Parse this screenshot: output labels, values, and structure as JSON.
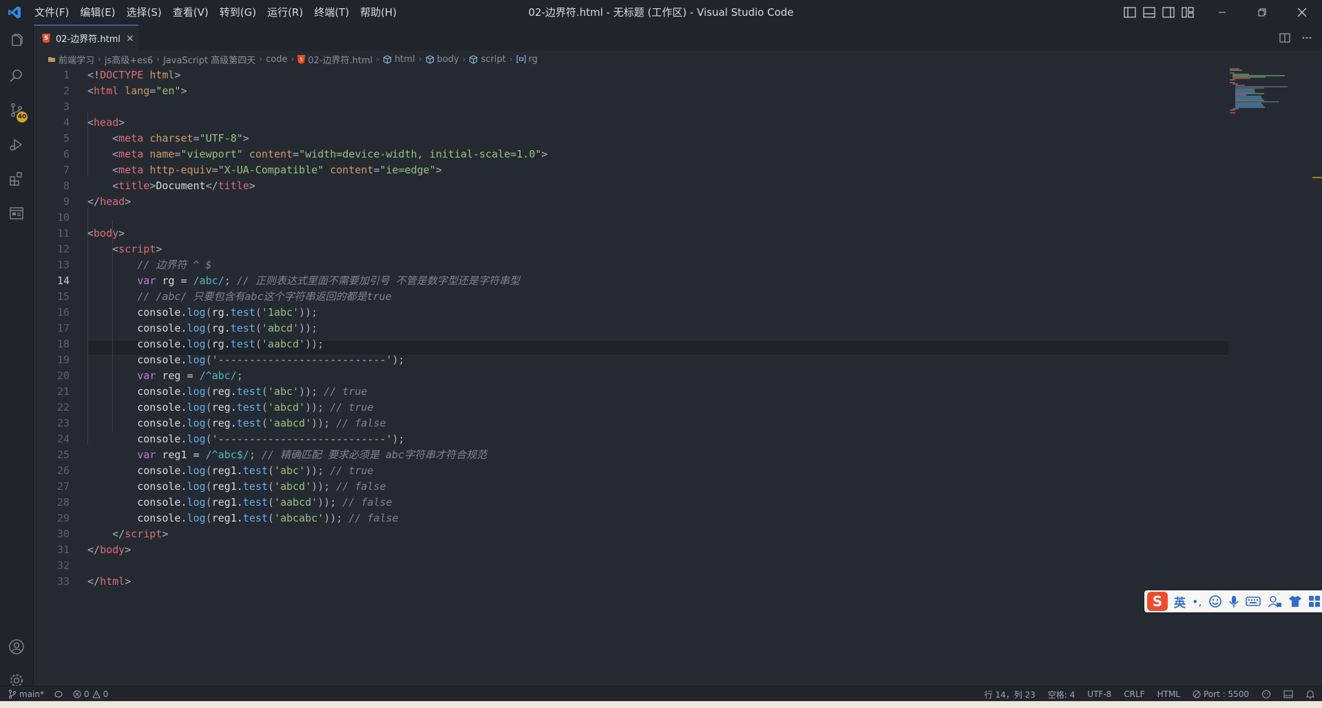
{
  "window": {
    "title": "02-边界符.html - 无标题 (工作区) - Visual Studio Code"
  },
  "menu": [
    "文件(F)",
    "编辑(E)",
    "选择(S)",
    "查看(V)",
    "转到(G)",
    "运行(R)",
    "终端(T)",
    "帮助(H)"
  ],
  "activity": {
    "scm_badge": "40"
  },
  "tab": {
    "label": "02-边界符.html",
    "close": "×",
    "icon_text": "5"
  },
  "breadcrumb": [
    {
      "label": "前端学习",
      "icon": "folder-icon"
    },
    {
      "label": "js高级+es6",
      "icon": ""
    },
    {
      "label": "JavaScript 高级第四天",
      "icon": ""
    },
    {
      "label": "code",
      "icon": ""
    },
    {
      "label": "02-边界符.html",
      "icon": "html5-icon"
    },
    {
      "label": "html",
      "icon": "cube-icon"
    },
    {
      "label": "body",
      "icon": "cube-icon"
    },
    {
      "label": "script",
      "icon": "cube-icon"
    },
    {
      "label": "rg",
      "icon": "variable-icon"
    }
  ],
  "editor": {
    "active_line": 14,
    "lines": [
      [
        [
          "t-punc",
          "<!"
        ],
        [
          "t-tag",
          "DOCTYPE"
        ],
        [
          "t-plain",
          " "
        ],
        [
          "t-attr",
          "html"
        ],
        [
          "t-punc",
          ">"
        ]
      ],
      [
        [
          "t-punc",
          "<"
        ],
        [
          "t-tag",
          "html"
        ],
        [
          "t-plain",
          " "
        ],
        [
          "t-attr",
          "lang"
        ],
        [
          "t-punc",
          "="
        ],
        [
          "t-str",
          "\"en\""
        ],
        [
          "t-punc",
          ">"
        ]
      ],
      [],
      [
        [
          "t-punc",
          "<"
        ],
        [
          "t-tag",
          "head"
        ],
        [
          "t-punc",
          ">"
        ]
      ],
      [
        [
          "t-plain",
          "    "
        ],
        [
          "t-punc",
          "<"
        ],
        [
          "t-tag",
          "meta"
        ],
        [
          "t-plain",
          " "
        ],
        [
          "t-attr",
          "charset"
        ],
        [
          "t-punc",
          "="
        ],
        [
          "t-str",
          "\"UTF-8\""
        ],
        [
          "t-punc",
          ">"
        ]
      ],
      [
        [
          "t-plain",
          "    "
        ],
        [
          "t-punc",
          "<"
        ],
        [
          "t-tag",
          "meta"
        ],
        [
          "t-plain",
          " "
        ],
        [
          "t-attr",
          "name"
        ],
        [
          "t-punc",
          "="
        ],
        [
          "t-str",
          "\"viewport\""
        ],
        [
          "t-plain",
          " "
        ],
        [
          "t-attr",
          "content"
        ],
        [
          "t-punc",
          "="
        ],
        [
          "t-str",
          "\"width=device-width, initial-scale=1.0\""
        ],
        [
          "t-punc",
          ">"
        ]
      ],
      [
        [
          "t-plain",
          "    "
        ],
        [
          "t-punc",
          "<"
        ],
        [
          "t-tag",
          "meta"
        ],
        [
          "t-plain",
          " "
        ],
        [
          "t-attr",
          "http-equiv"
        ],
        [
          "t-punc",
          "="
        ],
        [
          "t-str",
          "\"X-UA-Compatible\""
        ],
        [
          "t-plain",
          " "
        ],
        [
          "t-attr",
          "content"
        ],
        [
          "t-punc",
          "="
        ],
        [
          "t-str",
          "\"ie=edge\""
        ],
        [
          "t-punc",
          ">"
        ]
      ],
      [
        [
          "t-plain",
          "    "
        ],
        [
          "t-punc",
          "<"
        ],
        [
          "t-tag",
          "title"
        ],
        [
          "t-punc",
          ">"
        ],
        [
          "t-plain",
          "Document"
        ],
        [
          "t-punc",
          "</"
        ],
        [
          "t-tag",
          "title"
        ],
        [
          "t-punc",
          ">"
        ]
      ],
      [
        [
          "t-punc",
          "</"
        ],
        [
          "t-tag",
          "head"
        ],
        [
          "t-punc",
          ">"
        ]
      ],
      [],
      [
        [
          "t-punc",
          "<"
        ],
        [
          "t-tag",
          "body"
        ],
        [
          "t-punc",
          ">"
        ]
      ],
      [
        [
          "t-plain",
          "    "
        ],
        [
          "t-punc",
          "<"
        ],
        [
          "t-tag",
          "script"
        ],
        [
          "t-punc",
          ">"
        ]
      ],
      [
        [
          "t-plain",
          "        "
        ],
        [
          "t-comment",
          "// 边界符 ^ $"
        ]
      ],
      [
        [
          "t-plain",
          "        "
        ],
        [
          "t-kw",
          "var"
        ],
        [
          "t-plain",
          " rg = "
        ],
        [
          "t-regex",
          "/abc/"
        ],
        [
          "t-punc",
          ";"
        ],
        [
          "t-plain",
          " "
        ],
        [
          "t-comment",
          "// 正则表达式里面不需要加引号 不管是数字型还是字符串型"
        ]
      ],
      [
        [
          "t-plain",
          "        "
        ],
        [
          "t-comment",
          "// /abc/ 只要包含有abc这个字符串返回的都是true"
        ]
      ],
      [
        [
          "t-plain",
          "        console."
        ],
        [
          "t-fn",
          "log"
        ],
        [
          "t-punc",
          "("
        ],
        [
          "t-plain",
          "rg."
        ],
        [
          "t-fn",
          "test"
        ],
        [
          "t-punc",
          "("
        ],
        [
          "t-str",
          "'1abc'"
        ],
        [
          "t-punc",
          "));"
        ]
      ],
      [
        [
          "t-plain",
          "        console."
        ],
        [
          "t-fn",
          "log"
        ],
        [
          "t-punc",
          "("
        ],
        [
          "t-plain",
          "rg."
        ],
        [
          "t-fn",
          "test"
        ],
        [
          "t-punc",
          "("
        ],
        [
          "t-str",
          "'abcd'"
        ],
        [
          "t-punc",
          "));"
        ]
      ],
      [
        [
          "t-plain",
          "        console."
        ],
        [
          "t-fn",
          "log"
        ],
        [
          "t-punc",
          "("
        ],
        [
          "t-plain",
          "rg."
        ],
        [
          "t-fn",
          "test"
        ],
        [
          "t-punc",
          "("
        ],
        [
          "t-str",
          "'aabcd'"
        ],
        [
          "t-punc",
          "));"
        ]
      ],
      [
        [
          "t-plain",
          "        console."
        ],
        [
          "t-fn",
          "log"
        ],
        [
          "t-punc",
          "("
        ],
        [
          "t-str",
          "'---------------------------'"
        ],
        [
          "t-punc",
          ");"
        ]
      ],
      [
        [
          "t-plain",
          "        "
        ],
        [
          "t-kw",
          "var"
        ],
        [
          "t-plain",
          " reg = "
        ],
        [
          "t-regex",
          "/^abc/"
        ],
        [
          "t-punc",
          ";"
        ]
      ],
      [
        [
          "t-plain",
          "        console."
        ],
        [
          "t-fn",
          "log"
        ],
        [
          "t-punc",
          "("
        ],
        [
          "t-plain",
          "reg."
        ],
        [
          "t-fn",
          "test"
        ],
        [
          "t-punc",
          "("
        ],
        [
          "t-str",
          "'abc'"
        ],
        [
          "t-punc",
          "));"
        ],
        [
          "t-plain",
          " "
        ],
        [
          "t-comment",
          "// true"
        ]
      ],
      [
        [
          "t-plain",
          "        console."
        ],
        [
          "t-fn",
          "log"
        ],
        [
          "t-punc",
          "("
        ],
        [
          "t-plain",
          "reg."
        ],
        [
          "t-fn",
          "test"
        ],
        [
          "t-punc",
          "("
        ],
        [
          "t-str",
          "'abcd'"
        ],
        [
          "t-punc",
          "));"
        ],
        [
          "t-plain",
          " "
        ],
        [
          "t-comment",
          "// true"
        ]
      ],
      [
        [
          "t-plain",
          "        console."
        ],
        [
          "t-fn",
          "log"
        ],
        [
          "t-punc",
          "("
        ],
        [
          "t-plain",
          "reg."
        ],
        [
          "t-fn",
          "test"
        ],
        [
          "t-punc",
          "("
        ],
        [
          "t-str",
          "'aabcd'"
        ],
        [
          "t-punc",
          "));"
        ],
        [
          "t-plain",
          " "
        ],
        [
          "t-comment",
          "// false"
        ]
      ],
      [
        [
          "t-plain",
          "        console."
        ],
        [
          "t-fn",
          "log"
        ],
        [
          "t-punc",
          "("
        ],
        [
          "t-str",
          "'---------------------------'"
        ],
        [
          "t-punc",
          ");"
        ]
      ],
      [
        [
          "t-plain",
          "        "
        ],
        [
          "t-kw",
          "var"
        ],
        [
          "t-plain",
          " reg1 = "
        ],
        [
          "t-regex",
          "/^abc$/"
        ],
        [
          "t-punc",
          ";"
        ],
        [
          "t-plain",
          " "
        ],
        [
          "t-comment",
          "// 精确匹配 要求必须是 abc字符串才符合规范"
        ]
      ],
      [
        [
          "t-plain",
          "        console."
        ],
        [
          "t-fn",
          "log"
        ],
        [
          "t-punc",
          "("
        ],
        [
          "t-plain",
          "reg1."
        ],
        [
          "t-fn",
          "test"
        ],
        [
          "t-punc",
          "("
        ],
        [
          "t-str",
          "'abc'"
        ],
        [
          "t-punc",
          "));"
        ],
        [
          "t-plain",
          " "
        ],
        [
          "t-comment",
          "// true"
        ]
      ],
      [
        [
          "t-plain",
          "        console."
        ],
        [
          "t-fn",
          "log"
        ],
        [
          "t-punc",
          "("
        ],
        [
          "t-plain",
          "reg1."
        ],
        [
          "t-fn",
          "test"
        ],
        [
          "t-punc",
          "("
        ],
        [
          "t-str",
          "'abcd'"
        ],
        [
          "t-punc",
          "));"
        ],
        [
          "t-plain",
          " "
        ],
        [
          "t-comment",
          "// false"
        ]
      ],
      [
        [
          "t-plain",
          "        console."
        ],
        [
          "t-fn",
          "log"
        ],
        [
          "t-punc",
          "("
        ],
        [
          "t-plain",
          "reg1."
        ],
        [
          "t-fn",
          "test"
        ],
        [
          "t-punc",
          "("
        ],
        [
          "t-str",
          "'aabcd'"
        ],
        [
          "t-punc",
          "));"
        ],
        [
          "t-plain",
          " "
        ],
        [
          "t-comment",
          "// false"
        ]
      ],
      [
        [
          "t-plain",
          "        console."
        ],
        [
          "t-fn",
          "log"
        ],
        [
          "t-punc",
          "("
        ],
        [
          "t-plain",
          "reg1."
        ],
        [
          "t-fn",
          "test"
        ],
        [
          "t-punc",
          "("
        ],
        [
          "t-str",
          "'abcabc'"
        ],
        [
          "t-punc",
          "));"
        ],
        [
          "t-plain",
          " "
        ],
        [
          "t-comment",
          "// false"
        ]
      ],
      [
        [
          "t-plain",
          "    "
        ],
        [
          "t-punc",
          "</"
        ],
        [
          "t-tag",
          "script"
        ],
        [
          "t-punc",
          ">"
        ]
      ],
      [
        [
          "t-punc",
          "</"
        ],
        [
          "t-tag",
          "body"
        ],
        [
          "t-punc",
          ">"
        ]
      ],
      [],
      [
        [
          "t-punc",
          "</"
        ],
        [
          "t-tag",
          "html"
        ],
        [
          "t-punc",
          ">"
        ]
      ]
    ]
  },
  "statusbar": {
    "branch": "main*",
    "errors": "0",
    "warnings": "0",
    "position": "行 14，列 23",
    "indent": "空格: 4",
    "encoding": "UTF-8",
    "eol": "CRLF",
    "language": "HTML",
    "port": "Port : 5500"
  },
  "ime": {
    "logo": "S",
    "lang": "英",
    "punct": "•,"
  },
  "colors": {
    "accent": "#528bff",
    "badge": "#d7a321",
    "editor_bg": "#252a32",
    "sidebar_bg": "#21252b"
  }
}
